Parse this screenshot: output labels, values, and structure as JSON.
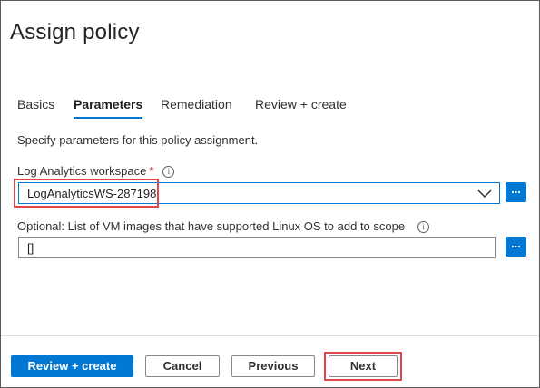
{
  "title": "Assign policy",
  "tabs": [
    {
      "label": "Basics"
    },
    {
      "label": "Parameters"
    },
    {
      "label": "Remediation"
    },
    {
      "label": "Review + create"
    }
  ],
  "description": "Specify parameters for this policy assignment.",
  "workspace": {
    "label": "Log Analytics workspace",
    "required_mark": "*",
    "info_icon": "i",
    "value": "LogAnalyticsWS-287198",
    "browse_label": "..."
  },
  "vm_images": {
    "label": "Optional: List of VM images that have supported Linux OS to add to scope",
    "info_icon": "i",
    "value": "[]",
    "browse_label": "..."
  },
  "footer": {
    "review_create": "Review + create",
    "cancel": "Cancel",
    "previous": "Previous",
    "next": "Next"
  },
  "colors": {
    "accent": "#0078d4",
    "highlight": "#e0474c",
    "required": "#a4262c"
  }
}
